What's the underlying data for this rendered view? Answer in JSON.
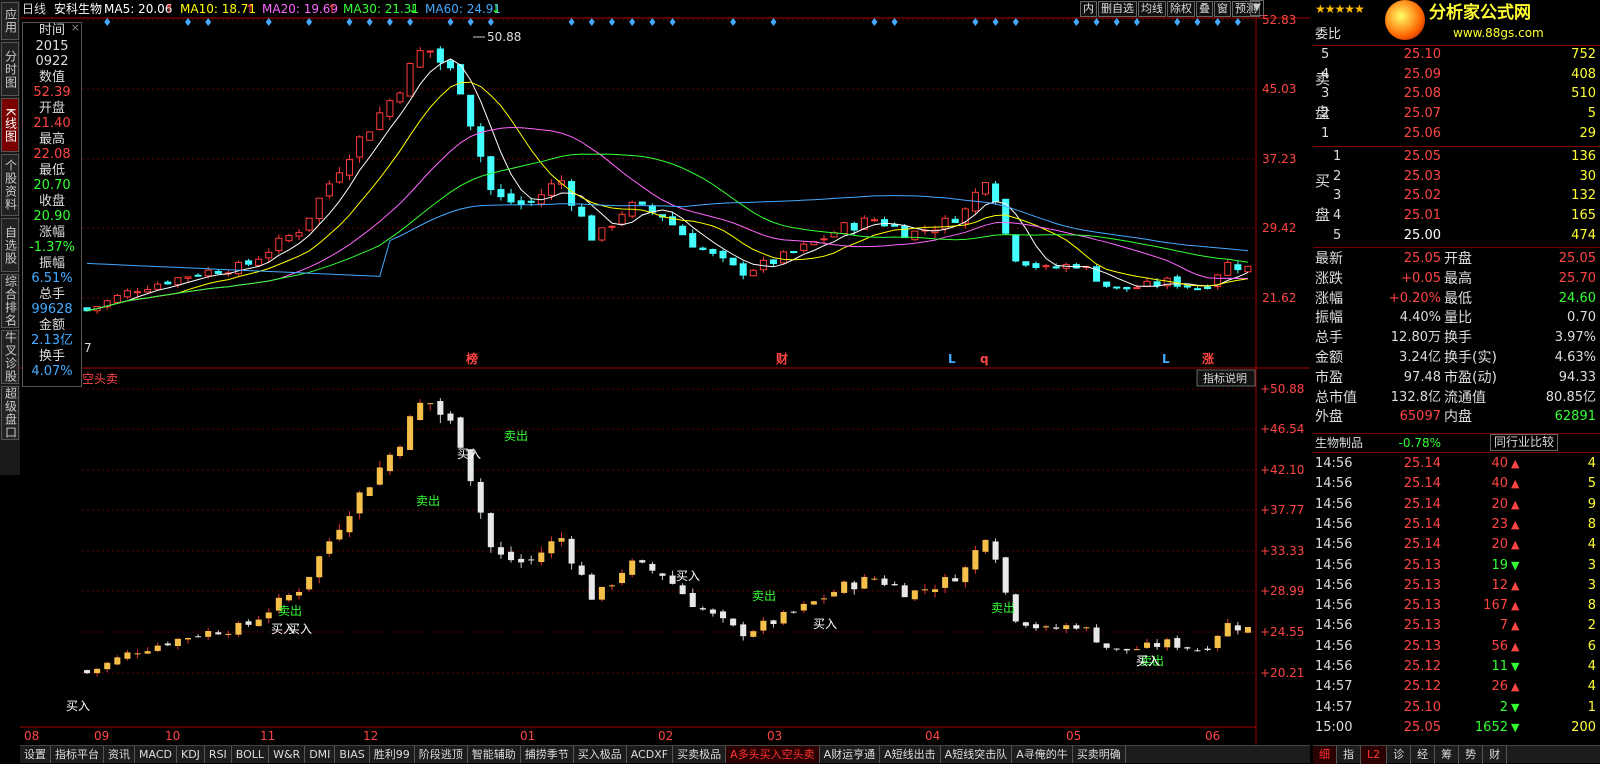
{
  "vtabs": [
    "应用",
    "分时图",
    "K线图",
    "个股资料",
    "自选股",
    "综合排名",
    "牛叉诊股",
    "超级盘口"
  ],
  "toolbar": {
    "period": "日线",
    "stock": "安科生物",
    "ma5": "MA5: 20.06",
    "ma10": "MA10: 18.71",
    "ma20": "MA20: 19.69",
    "ma30": "MA30: 21.31",
    "ma60": "MA60: 24.91",
    "buttons": [
      "内",
      "删自选",
      "均线",
      "除权",
      "叠",
      "窗",
      "预测"
    ]
  },
  "info": {
    "time_label": "时间",
    "date_y": "2015",
    "date_md": "0922",
    "value_label": "数值",
    "value": "52.39",
    "open_label": "开盘",
    "open": "21.40",
    "high_label": "最高",
    "high": "22.08",
    "low_label": "最低",
    "low": "20.70",
    "close_label": "收盘",
    "close": "20.90",
    "chg_label": "涨幅",
    "chg": "-1.37%",
    "amp_label": "振幅",
    "amp": "6.51%",
    "vol_label": "总手",
    "vol": "99628",
    "amt_label": "金额",
    "amt": "2.13亿",
    "turn_label": "换手",
    "turn": "4.07%"
  },
  "main_price_labels": [
    "52.83",
    "45.03",
    "37.23",
    "29.42",
    "21.62"
  ],
  "ind_price_labels": [
    "+50.88",
    "+46.54",
    "+42.10",
    "+37.77",
    "+33.33",
    "+28.99",
    "+24.55",
    "+20.21"
  ],
  "max_label": "50.88",
  "left_num": "7",
  "markers": [
    {
      "t": "榜",
      "c": "#f44"
    },
    {
      "t": "财",
      "c": "#f44"
    },
    {
      "t": "L",
      "c": "#4af"
    },
    {
      "t": "q",
      "c": "#f44"
    },
    {
      "t": "L",
      "c": "#4af"
    },
    {
      "t": "涨",
      "c": "#f44"
    }
  ],
  "ind_name": "空头卖",
  "ind_btn": "指标说明",
  "ind_labels": [
    {
      "t": "买入",
      "c": "#fff"
    },
    {
      "t": "卖出",
      "c": "#3f3"
    },
    {
      "t": "买入",
      "c": "#fff"
    },
    {
      "t": "买入",
      "c": "#fff"
    },
    {
      "t": "卖出",
      "c": "#3f3"
    },
    {
      "t": "买入",
      "c": "#fff"
    },
    {
      "t": "卖出",
      "c": "#3f3"
    },
    {
      "t": "买入",
      "c": "#fff"
    },
    {
      "t": "买入",
      "c": "#fff"
    },
    {
      "t": "卖出",
      "c": "#3f3"
    },
    {
      "t": "卖出",
      "c": "#3f3"
    },
    {
      "t": "买入",
      "c": "#fff"
    },
    {
      "t": "卖出",
      "c": "#3f3"
    },
    {
      "t": "买入",
      "c": "#fff"
    }
  ],
  "xaxis": [
    "08",
    "09",
    "10",
    "11",
    "12",
    "01",
    "02",
    "03",
    "04",
    "05",
    "06"
  ],
  "bottom_tabs": [
    "设置",
    "指标平台",
    "资讯",
    "MACD",
    "KDJ",
    "RSI",
    "BOLL",
    "W&R",
    "DMI",
    "BIAS",
    "胜利99",
    "阶段逃顶",
    "智能辅助",
    "捕捞季节",
    "买入极品",
    "ACDXF",
    "买卖极品",
    "A多头买入空头卖",
    "A财运亨通",
    "A短线出击",
    "A短线突击队",
    "A寻俺的牛",
    "买卖明确"
  ],
  "bottom_active": "A多头买入空头卖",
  "rp": {
    "brand": "分析家公式网",
    "url": "www.88gs.com",
    "wb": "委比",
    "sells": [
      {
        "n": "5",
        "p": "25.10",
        "v": "752"
      },
      {
        "n": "4",
        "p": "25.09",
        "v": "408"
      },
      {
        "n": "3",
        "p": "25.08",
        "v": "510"
      },
      {
        "n": "2",
        "p": "25.07",
        "v": "5"
      },
      {
        "n": "1",
        "p": "25.06",
        "v": "29"
      }
    ],
    "buys": [
      {
        "n": "1",
        "p": "25.05",
        "v": "136"
      },
      {
        "n": "2",
        "p": "25.03",
        "v": "30"
      },
      {
        "n": "3",
        "p": "25.02",
        "v": "132"
      },
      {
        "n": "4",
        "p": "25.01",
        "v": "165"
      },
      {
        "n": "5",
        "p": "25.00",
        "v": "474"
      }
    ],
    "sell_label": [
      "卖",
      "盘"
    ],
    "buy_label": [
      "买",
      "盘"
    ],
    "quote": [
      {
        "l1": "最新",
        "v1": "25.05",
        "c1": "#f44",
        "l2": "开盘",
        "v2": "25.05",
        "c2": "#f44"
      },
      {
        "l1": "涨跌",
        "v1": "+0.05",
        "c1": "#f44",
        "l2": "最高",
        "v2": "25.70",
        "c2": "#f44"
      },
      {
        "l1": "涨幅",
        "v1": "+0.20%",
        "c1": "#f44",
        "l2": "最低",
        "v2": "24.60",
        "c2": "#3f3"
      },
      {
        "l1": "振幅",
        "v1": "4.40%",
        "c1": "#ddd",
        "l2": "量比",
        "v2": "0.70",
        "c2": "#ddd"
      },
      {
        "l1": "总手",
        "v1": "12.80万",
        "c1": "#ddd",
        "l2": "换手",
        "v2": "3.97%",
        "c2": "#ddd"
      },
      {
        "l1": "金额",
        "v1": "3.24亿",
        "c1": "#ddd",
        "l2": "换手(实)",
        "v2": "4.63%",
        "c2": "#ddd"
      },
      {
        "l1": "市盈",
        "v1": "97.48",
        "c1": "#ddd",
        "l2": "市盈(动)",
        "v2": "94.33",
        "c2": "#ddd"
      },
      {
        "l1": "总市值",
        "v1": "132.8亿",
        "c1": "#ddd",
        "l2": "流通值",
        "v2": "80.85亿",
        "c2": "#ddd"
      },
      {
        "l1": "外盘",
        "v1": "65097",
        "c1": "#f44",
        "l2": "内盘",
        "v2": "62891",
        "c2": "#3f3"
      }
    ],
    "industry": "生物制品",
    "industry_chg": "-0.78%",
    "compare": "同行业比较",
    "ticks": [
      {
        "t": "14:56",
        "p": "25.14",
        "v": "40",
        "d": "up",
        "n": "4"
      },
      {
        "t": "14:56",
        "p": "25.14",
        "v": "40",
        "d": "up",
        "n": "5"
      },
      {
        "t": "14:56",
        "p": "25.14",
        "v": "20",
        "d": "up",
        "n": "9"
      },
      {
        "t": "14:56",
        "p": "25.14",
        "v": "23",
        "d": "up",
        "n": "8"
      },
      {
        "t": "14:56",
        "p": "25.14",
        "v": "20",
        "d": "up",
        "n": "4"
      },
      {
        "t": "14:56",
        "p": "25.13",
        "v": "19",
        "d": "dn",
        "n": "3"
      },
      {
        "t": "14:56",
        "p": "25.13",
        "v": "12",
        "d": "up",
        "n": "3"
      },
      {
        "t": "14:56",
        "p": "25.13",
        "v": "167",
        "d": "up",
        "n": "8"
      },
      {
        "t": "14:56",
        "p": "25.13",
        "v": "7",
        "d": "up",
        "n": "2"
      },
      {
        "t": "14:56",
        "p": "25.13",
        "v": "56",
        "d": "up",
        "n": "6"
      },
      {
        "t": "14:56",
        "p": "25.12",
        "v": "11",
        "d": "dn",
        "n": "4"
      },
      {
        "t": "14:57",
        "p": "25.12",
        "v": "26",
        "d": "up",
        "n": "4"
      },
      {
        "t": "14:57",
        "p": "25.10",
        "v": "2",
        "d": "dn",
        "n": "1"
      },
      {
        "t": "15:00",
        "p": "25.05",
        "v": "1652",
        "d": "dn",
        "n": "200"
      }
    ],
    "bottom": [
      "细",
      "指",
      "L2",
      "诊",
      "经",
      "筹",
      "势",
      "财"
    ]
  }
}
